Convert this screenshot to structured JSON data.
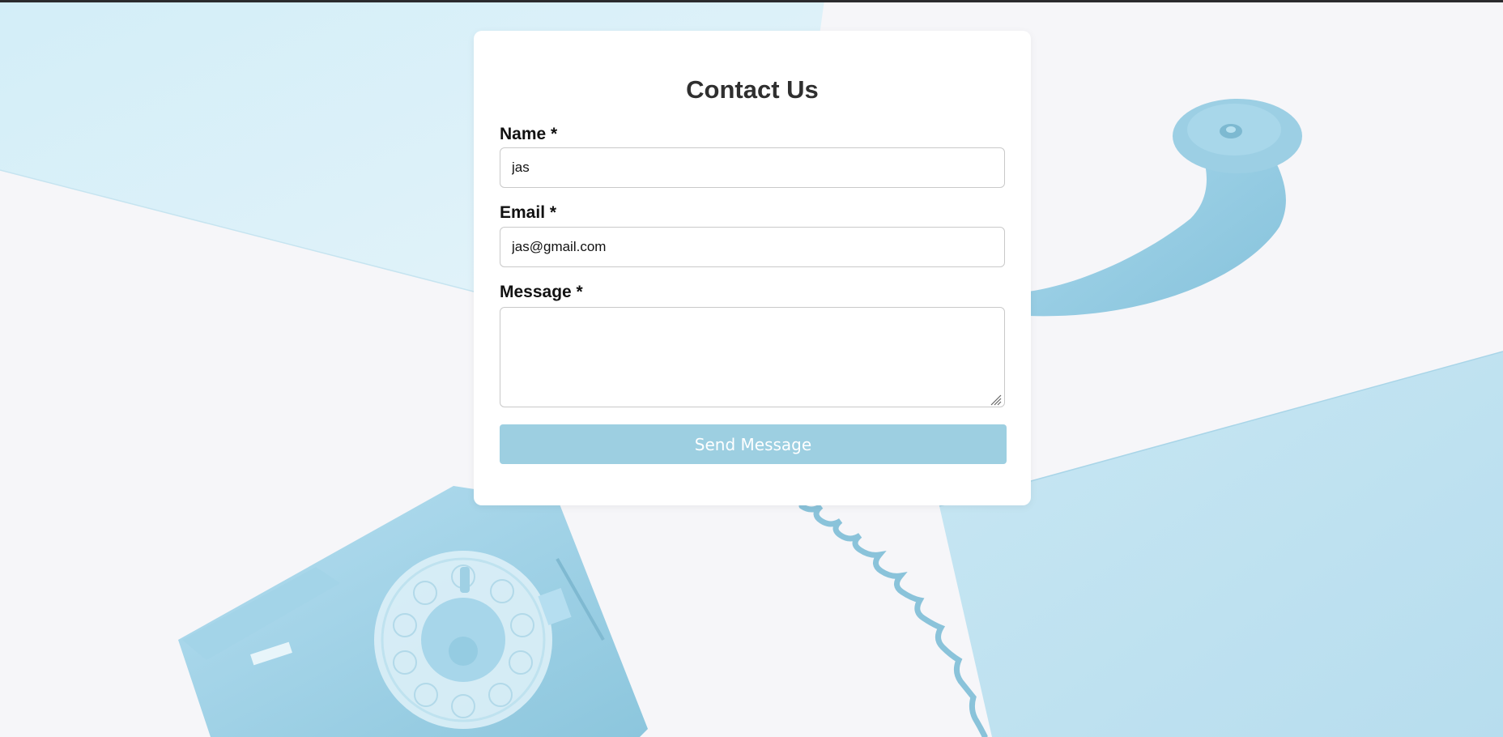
{
  "form": {
    "title": "Contact Us",
    "name_label": "Name *",
    "name_value": "jas",
    "email_label": "Email *",
    "email_value": "jas@gmail.com",
    "message_label": "Message *",
    "message_value": "",
    "submit_label": "Send Message"
  },
  "colors": {
    "background_light_blue": "#dcf1f9",
    "background_white": "#f6f6f9",
    "phone_blue": "#9fd3e6",
    "button_color": "#9dcfe1",
    "card_background": "#ffffff"
  },
  "icons": [
    "resize-grip-icon"
  ]
}
